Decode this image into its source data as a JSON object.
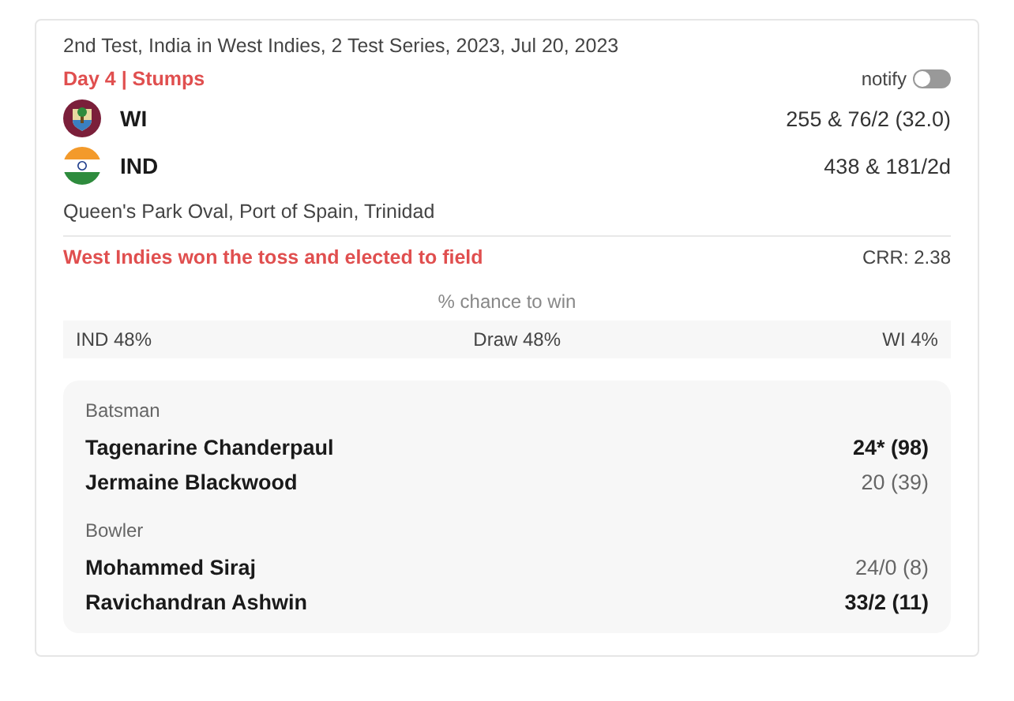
{
  "match": {
    "title": "2nd Test, India in West Indies, 2 Test Series, 2023, Jul 20, 2023",
    "status": "Day 4 | Stumps",
    "notify": {
      "label": "notify",
      "on": false
    }
  },
  "teams": [
    {
      "kind": "wi",
      "name": "WI",
      "score": "255 & 76/2 (32.0)"
    },
    {
      "kind": "ind",
      "name": "IND",
      "score": "438 & 181/2d"
    }
  ],
  "venue": "Queen's Park Oval, Port of Spain, Trinidad",
  "toss": "West Indies won the toss and elected to field",
  "crr": "CRR: 2.38",
  "win_chance": {
    "title": "% chance to win",
    "items": [
      "IND 48%",
      "Draw 48%",
      "WI 4%"
    ]
  },
  "sections": [
    {
      "heading": "Batsman",
      "players": [
        {
          "name": "Tagenarine Chanderpaul",
          "stat": "24* (98)",
          "current": true
        },
        {
          "name": "Jermaine Blackwood",
          "stat": "20 (39)",
          "current": false
        }
      ]
    },
    {
      "heading": "Bowler",
      "players": [
        {
          "name": "Mohammed Siraj",
          "stat": "24/0 (8)",
          "current": false
        },
        {
          "name": "Ravichandran Ashwin",
          "stat": "33/2 (11)",
          "current": true
        }
      ]
    }
  ]
}
